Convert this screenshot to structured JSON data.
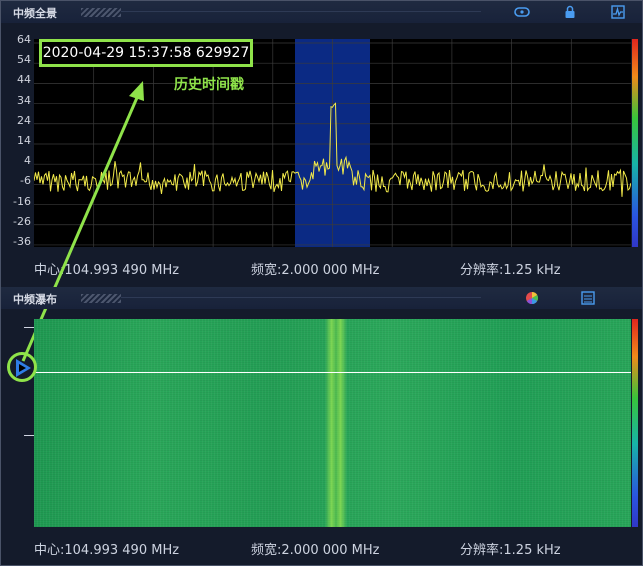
{
  "top_panel": {
    "title": "中频全景",
    "y_ticks": [
      "64",
      "54",
      "44",
      "34",
      "24",
      "14",
      "4",
      "-6",
      "-16",
      "-26",
      "-36"
    ],
    "timestamp": "2020-04-29 15:37:58 629927",
    "annotation": "历史时间戳",
    "icons": [
      "link-icon",
      "lock-icon",
      "spectrum-icon"
    ],
    "center_label": "中心:",
    "center_value": "104.993 490 MHz",
    "span_label": "频宽:",
    "span_value": "2.000 000 MHz",
    "rbw_label": "分辨率:",
    "rbw_value": "1.25 kHz",
    "colors": {
      "trace": "#f2ea4a",
      "highlight": "#0b2a84",
      "grid": "#3b3b3b",
      "accent": "#8fe34a"
    }
  },
  "bottom_panel": {
    "title": "中频瀑布",
    "icons": [
      "color-wheel-icon",
      "list-icon"
    ],
    "center_label": "中心:",
    "center_value": "104.993 490 MHz",
    "span_label": "频宽:",
    "span_value": "2.000 000 MHz",
    "rbw_label": "分辨率:",
    "rbw_value": "1.25 kHz"
  }
}
